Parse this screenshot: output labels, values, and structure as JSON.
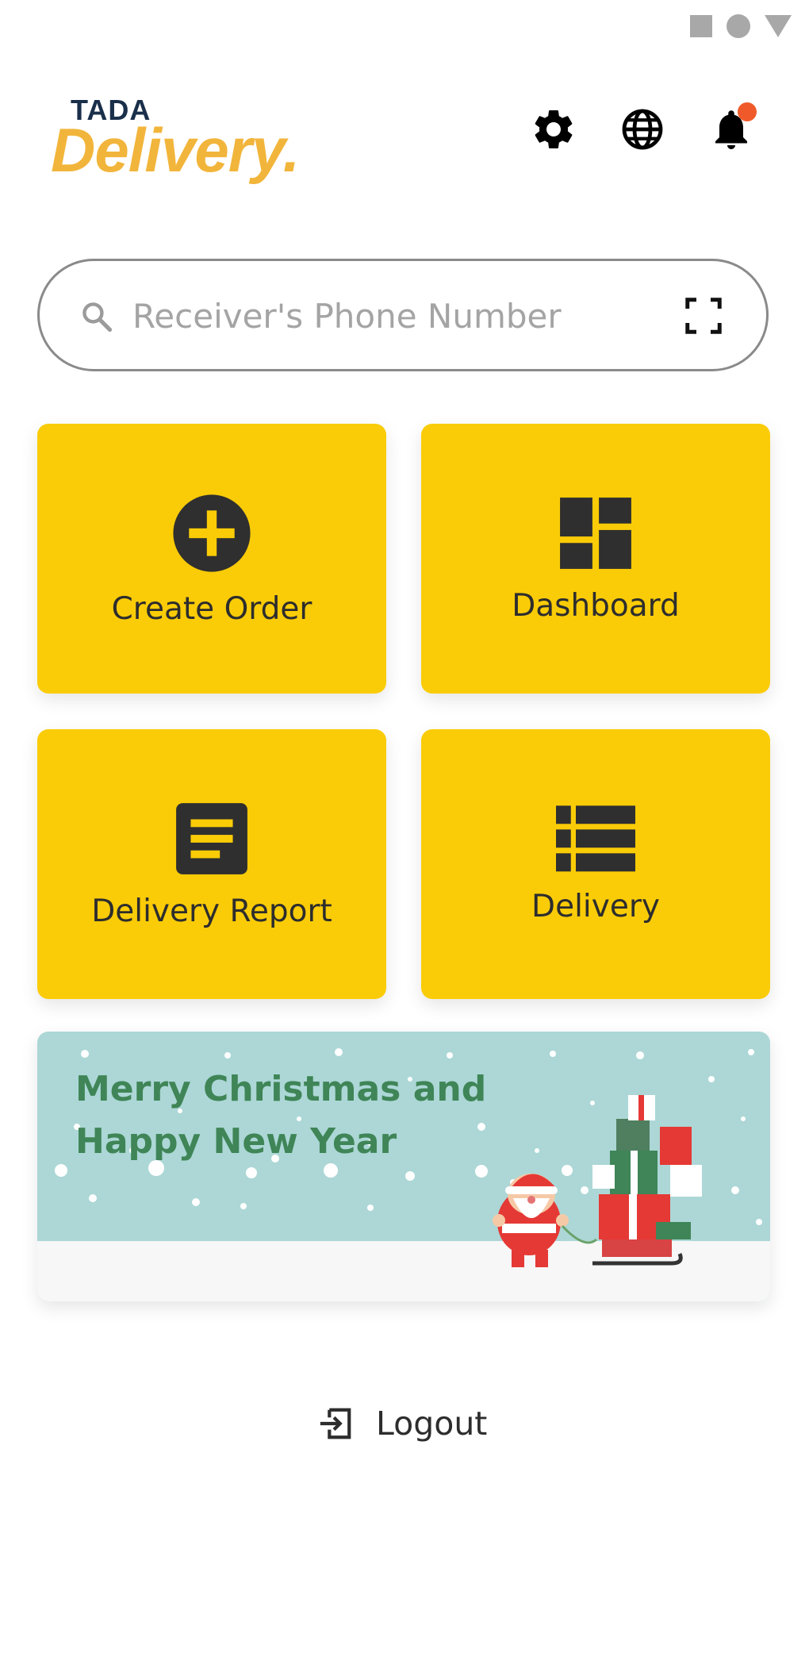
{
  "status_bar": {
    "icons": [
      "square-icon",
      "circle-icon",
      "triangle-icon"
    ],
    "color": "#a8a8a8"
  },
  "header": {
    "logo_top": "TADA",
    "logo_main": "Delivery.",
    "icons": [
      "gear-icon",
      "globe-icon",
      "bell-icon"
    ],
    "notification_badge": true
  },
  "search": {
    "placeholder": "Receiver's Phone Number",
    "value": ""
  },
  "tiles": [
    {
      "label": "Create Order",
      "icon": "plus-circle-icon"
    },
    {
      "label": "Dashboard",
      "icon": "dashboard-icon"
    },
    {
      "label": "Delivery Report",
      "icon": "report-icon"
    },
    {
      "label": "Delivery",
      "icon": "list-icon"
    }
  ],
  "banner": {
    "line1": "Merry Christmas and",
    "line2": "Happy New Year"
  },
  "logout": {
    "label": "Logout"
  },
  "colors": {
    "tile_bg": "#facc07",
    "brand_orange": "#f2b53b",
    "notification": "#f05a2a",
    "banner_text": "#3f8557",
    "banner_bg": "#acd7d6"
  }
}
